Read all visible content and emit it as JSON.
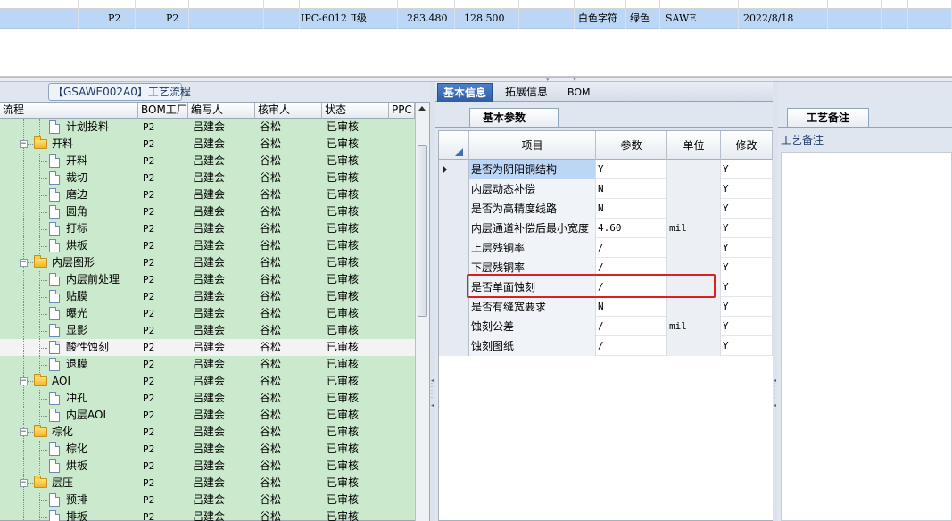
{
  "top_grid": {
    "selected_row": [
      "P2",
      "P2",
      "IPC-6012 Ⅱ级",
      "283.480",
      "128.500",
      "白色字符",
      "绿色",
      "SAWE",
      "2022/8/18"
    ]
  },
  "tree": {
    "title": "【GSAWE002A0】工艺流程",
    "columns": [
      "流程",
      "BOM工厂",
      "编写人",
      "核审人",
      "状态",
      "PPC"
    ],
    "rows": [
      {
        "level": 2,
        "type": "doc",
        "name": "计划投料",
        "bom": "P2",
        "writer": "吕建会",
        "reviewer": "谷松",
        "status": "已审核"
      },
      {
        "level": 1,
        "type": "folder",
        "name": "开料",
        "bom": "P2",
        "writer": "吕建会",
        "reviewer": "谷松",
        "status": "已审核"
      },
      {
        "level": 2,
        "type": "doc",
        "name": "开料",
        "bom": "P2",
        "writer": "吕建会",
        "reviewer": "谷松",
        "status": "已审核"
      },
      {
        "level": 2,
        "type": "doc",
        "name": "裁切",
        "bom": "P2",
        "writer": "吕建会",
        "reviewer": "谷松",
        "status": "已审核"
      },
      {
        "level": 2,
        "type": "doc",
        "name": "磨边",
        "bom": "P2",
        "writer": "吕建会",
        "reviewer": "谷松",
        "status": "已审核"
      },
      {
        "level": 2,
        "type": "doc",
        "name": "圆角",
        "bom": "P2",
        "writer": "吕建会",
        "reviewer": "谷松",
        "status": "已审核"
      },
      {
        "level": 2,
        "type": "doc",
        "name": "打标",
        "bom": "P2",
        "writer": "吕建会",
        "reviewer": "谷松",
        "status": "已审核"
      },
      {
        "level": 2,
        "type": "doc",
        "name": "烘板",
        "bom": "P2",
        "writer": "吕建会",
        "reviewer": "谷松",
        "status": "已审核"
      },
      {
        "level": 1,
        "type": "folder",
        "name": "内层图形",
        "bom": "P2",
        "writer": "吕建会",
        "reviewer": "谷松",
        "status": "已审核"
      },
      {
        "level": 2,
        "type": "doc",
        "name": "内层前处理",
        "bom": "P2",
        "writer": "吕建会",
        "reviewer": "谷松",
        "status": "已审核"
      },
      {
        "level": 2,
        "type": "doc",
        "name": "贴膜",
        "bom": "P2",
        "writer": "吕建会",
        "reviewer": "谷松",
        "status": "已审核"
      },
      {
        "level": 2,
        "type": "doc",
        "name": "曝光",
        "bom": "P2",
        "writer": "吕建会",
        "reviewer": "谷松",
        "status": "已审核"
      },
      {
        "level": 2,
        "type": "doc",
        "name": "显影",
        "bom": "P2",
        "writer": "吕建会",
        "reviewer": "谷松",
        "status": "已审核"
      },
      {
        "level": 2,
        "type": "doc",
        "name": "酸性蚀刻",
        "bom": "P2",
        "writer": "吕建会",
        "reviewer": "谷松",
        "status": "已审核",
        "selected": true
      },
      {
        "level": 2,
        "type": "doc",
        "name": "退膜",
        "bom": "P2",
        "writer": "吕建会",
        "reviewer": "谷松",
        "status": "已审核"
      },
      {
        "level": 1,
        "type": "folder",
        "name": "AOI",
        "bom": "P2",
        "writer": "吕建会",
        "reviewer": "谷松",
        "status": "已审核"
      },
      {
        "level": 2,
        "type": "doc",
        "name": "冲孔",
        "bom": "P2",
        "writer": "吕建会",
        "reviewer": "谷松",
        "status": "已审核"
      },
      {
        "level": 2,
        "type": "doc",
        "name": "内层AOI",
        "bom": "P2",
        "writer": "吕建会",
        "reviewer": "谷松",
        "status": "已审核"
      },
      {
        "level": 1,
        "type": "folder",
        "name": "棕化",
        "bom": "P2",
        "writer": "吕建会",
        "reviewer": "谷松",
        "status": "已审核"
      },
      {
        "level": 2,
        "type": "doc",
        "name": "棕化",
        "bom": "P2",
        "writer": "吕建会",
        "reviewer": "谷松",
        "status": "已审核"
      },
      {
        "level": 2,
        "type": "doc",
        "name": "烘板",
        "bom": "P2",
        "writer": "吕建会",
        "reviewer": "谷松",
        "status": "已审核"
      },
      {
        "level": 1,
        "type": "folder",
        "name": "层压",
        "bom": "P2",
        "writer": "吕建会",
        "reviewer": "谷松",
        "status": "已审核"
      },
      {
        "level": 2,
        "type": "doc",
        "name": "预排",
        "bom": "P2",
        "writer": "吕建会",
        "reviewer": "谷松",
        "status": "已审核"
      },
      {
        "level": 2,
        "type": "doc",
        "name": "排板",
        "bom": "P2",
        "writer": "吕建会",
        "reviewer": "谷松",
        "status": "已审核"
      }
    ]
  },
  "tabs": [
    "基本信息",
    "拓展信息",
    "BOM"
  ],
  "subtab": "基本参数",
  "params": {
    "columns": [
      "项目",
      "参数",
      "单位",
      "修改"
    ],
    "rows": [
      {
        "item": "是否为阴阳铜结构",
        "value": "Y",
        "unit": "",
        "modify": "Y",
        "current": true
      },
      {
        "item": "内层动态补偿",
        "value": "N",
        "unit": "",
        "modify": "Y"
      },
      {
        "item": "是否为高精度线路",
        "value": "N",
        "unit": "",
        "modify": "Y"
      },
      {
        "item": "内层通道补偿后最小宽度",
        "value": "4.60",
        "unit": "mil",
        "modify": "Y"
      },
      {
        "item": "上层残铜率",
        "value": "/",
        "unit": "",
        "modify": "Y"
      },
      {
        "item": "下层残铜率",
        "value": "/",
        "unit": "",
        "modify": "Y"
      },
      {
        "item": "是否单面蚀刻",
        "value": "/",
        "unit": "",
        "modify": "Y"
      },
      {
        "item": "是否有缝宽要求",
        "value": "N",
        "unit": "",
        "modify": "Y"
      },
      {
        "item": "蚀刻公差",
        "value": "/",
        "unit": "mil",
        "modify": "Y"
      },
      {
        "item": "蚀刻图纸",
        "value": "/",
        "unit": "",
        "modify": "Y"
      }
    ]
  },
  "notes": {
    "tab": "工艺备注",
    "label": "工艺备注"
  },
  "colors": {
    "tree_bg": "#cbe9cd",
    "selection_blue": "#bcd7f6",
    "tab_active": "#2f5da6",
    "highlight_red": "#d92121"
  }
}
